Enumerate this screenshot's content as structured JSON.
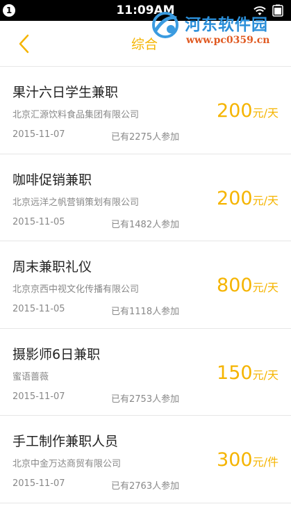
{
  "status_bar": {
    "notification_count": "1",
    "time": "11:09AM"
  },
  "watermark": {
    "title": "河东软件园",
    "url": "www.pc0359.cn"
  },
  "header": {
    "back_icon": "chevron-left-icon",
    "tab_label": "综合"
  },
  "colors": {
    "accent": "#f5b400",
    "text_primary": "#222222",
    "text_secondary": "#888888",
    "divider": "#e6e6e6"
  },
  "jobs": [
    {
      "title": "果汁六日学生兼职",
      "company": "北京汇源饮料食品集团有限公司",
      "date": "2015-11-07",
      "participants": "已有2275人参加",
      "salary": "200",
      "unit": "元/天"
    },
    {
      "title": "咖啡促销兼职",
      "company": "北京远洋之帆营销策划有限公司",
      "date": "2015-11-05",
      "participants": "已有1482人参加",
      "salary": "200",
      "unit": "元/天"
    },
    {
      "title": "周末兼职礼仪",
      "company": "北京京西中视文化传播有限公司",
      "date": "2015-11-05",
      "participants": "已有1118人参加",
      "salary": "800",
      "unit": "元/天"
    },
    {
      "title": "摄影师6日兼职",
      "company": "蜜语蔷薇",
      "date": "2015-11-07",
      "participants": "已有2753人参加",
      "salary": "150",
      "unit": "元/天"
    },
    {
      "title": "手工制作兼职人员",
      "company": "北京中金万达商贸有限公司",
      "date": "2015-11-07",
      "participants": "已有2763人参加",
      "salary": "300",
      "unit": "元/件"
    }
  ]
}
